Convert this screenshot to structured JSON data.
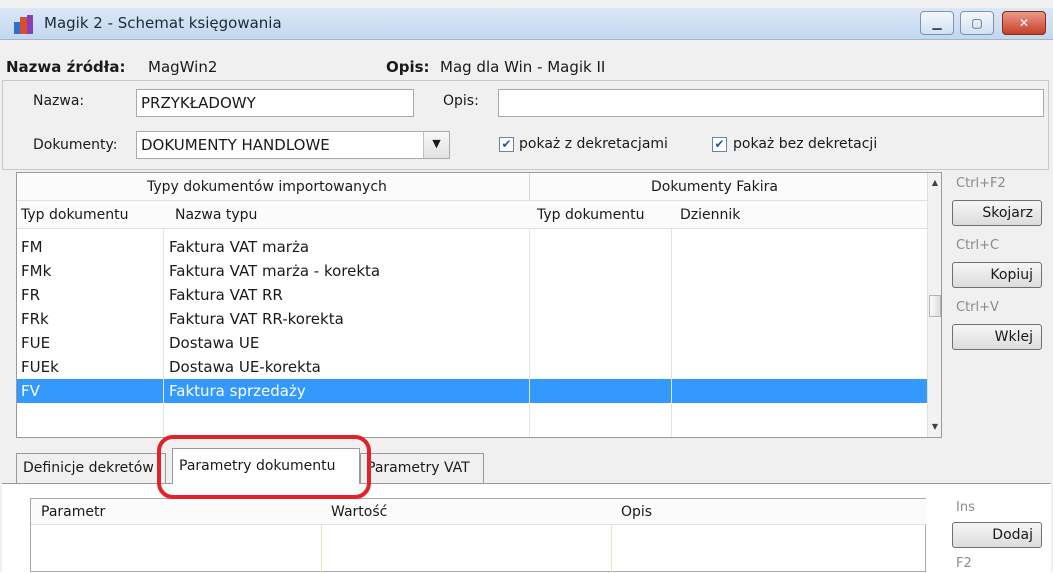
{
  "window": {
    "title": "Magik 2 - Schemat księgowania",
    "controls": {
      "minimize": "▁",
      "maximize": "▢",
      "close": "✕"
    },
    "close_color": "#c6402a"
  },
  "source": {
    "name_label": "Nazwa źródła:",
    "name_value": "MagWin2",
    "desc_label": "Opis:",
    "desc_value": "Mag dla Win - Magik II"
  },
  "form": {
    "nazwa_label": "Nazwa:",
    "nazwa_value": "PRZYKŁADOWY",
    "opis_label": "Opis:",
    "opis_value": "",
    "dokumenty_label": "Dokumenty:",
    "dokumenty_value": "DOKUMENTY HANDLOWE",
    "check1_label": "pokaż z dekretacjami",
    "check1_checked": true,
    "check2_label": "pokaż bez dekretacji",
    "check2_checked": true
  },
  "grid": {
    "group1": "Typy dokumentów importowanych",
    "group2": "Dokumenty Fakira",
    "columns": [
      "Typ dokumentu",
      "Nazwa typu",
      "Typ dokumentu",
      "Dziennik"
    ],
    "rows": [
      {
        "type": "FM",
        "name": "Faktura VAT marża"
      },
      {
        "type": "FMk",
        "name": "Faktura VAT marża - korekta"
      },
      {
        "type": "FR",
        "name": "Faktura VAT RR"
      },
      {
        "type": "FRk",
        "name": "Faktura VAT RR-korekta"
      },
      {
        "type": "FUE",
        "name": "Dostawa UE"
      },
      {
        "type": "FUEk",
        "name": "Dostawa UE-korekta"
      },
      {
        "type": "FV",
        "name": "Faktura sprzedaży",
        "selected": true
      }
    ],
    "selection_color": "#3399ff"
  },
  "side_actions": [
    {
      "shortcut": "Ctrl+F2",
      "label": "Skojarz"
    },
    {
      "shortcut": "Ctrl+C",
      "label": "Kopiuj"
    },
    {
      "shortcut": "Ctrl+V",
      "label": "Wklej"
    }
  ],
  "tabs": [
    {
      "label": "Definicje dekretów"
    },
    {
      "label": "Parametry dokumentu",
      "active": true
    },
    {
      "label": "Parametry VAT"
    }
  ],
  "highlight_color": "#e1222a",
  "params_grid": {
    "columns": [
      "Parametr",
      "Wartość",
      "Opis"
    ]
  },
  "param_actions": [
    {
      "shortcut": "Ins",
      "label": "Dodaj"
    },
    {
      "shortcut": "F2"
    }
  ]
}
